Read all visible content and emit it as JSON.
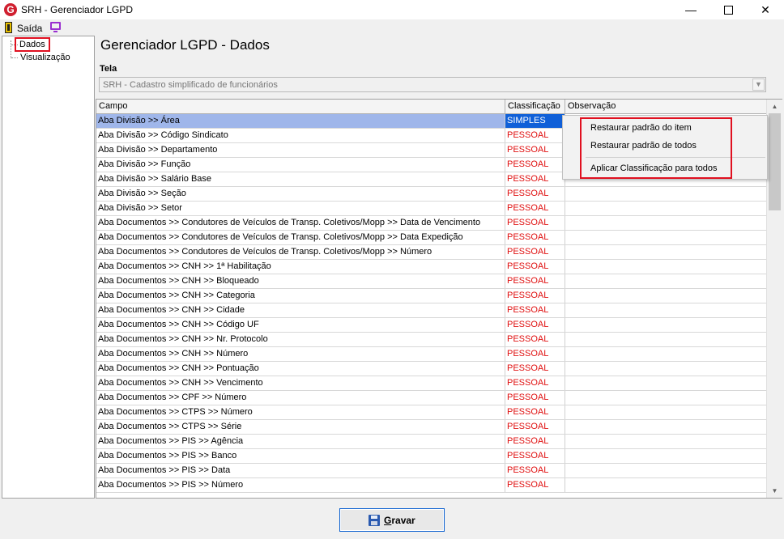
{
  "window": {
    "title": "SRH - Gerenciador LGPD",
    "logo_letter": "G",
    "minimize": "—",
    "close": "✕"
  },
  "toolbar": {
    "exit_label": "Saída"
  },
  "tree": {
    "items": [
      "Dados",
      "Visualização"
    ]
  },
  "main": {
    "title": "Gerenciador LGPD - Dados",
    "tela_label": "Tela",
    "tela_value": "SRH - Cadastro simplificado de funcionários"
  },
  "grid": {
    "columns": [
      "Campo",
      "Classificação",
      "Observação"
    ],
    "rows": [
      {
        "campo": "Aba Divisão >> Área",
        "classificacao": "SIMPLES",
        "observacao": ""
      },
      {
        "campo": "Aba Divisão >> Código Sindicato",
        "classificacao": "PESSOAL",
        "observacao": ""
      },
      {
        "campo": "Aba Divisão >> Departamento",
        "classificacao": "PESSOAL",
        "observacao": ""
      },
      {
        "campo": "Aba Divisão >> Função",
        "classificacao": "PESSOAL",
        "observacao": ""
      },
      {
        "campo": "Aba Divisão >> Salário Base",
        "classificacao": "PESSOAL",
        "observacao": ""
      },
      {
        "campo": "Aba Divisão >> Seção",
        "classificacao": "PESSOAL",
        "observacao": ""
      },
      {
        "campo": "Aba Divisão >> Setor",
        "classificacao": "PESSOAL",
        "observacao": ""
      },
      {
        "campo": "Aba Documentos >>  Condutores de Veículos de Transp. Coletivos/Mopp >> Data de Vencimento",
        "classificacao": "PESSOAL",
        "observacao": ""
      },
      {
        "campo": "Aba Documentos >>  Condutores de Veículos de Transp. Coletivos/Mopp >> Data Expedição",
        "classificacao": "PESSOAL",
        "observacao": ""
      },
      {
        "campo": "Aba Documentos >>  Condutores de Veículos de Transp. Coletivos/Mopp >> Número",
        "classificacao": "PESSOAL",
        "observacao": ""
      },
      {
        "campo": "Aba Documentos >> CNH >> 1ª Habilitação",
        "classificacao": "PESSOAL",
        "observacao": ""
      },
      {
        "campo": "Aba Documentos >> CNH >> Bloqueado",
        "classificacao": "PESSOAL",
        "observacao": ""
      },
      {
        "campo": "Aba Documentos >> CNH >> Categoria",
        "classificacao": "PESSOAL",
        "observacao": ""
      },
      {
        "campo": "Aba Documentos >> CNH >> Cidade",
        "classificacao": "PESSOAL",
        "observacao": ""
      },
      {
        "campo": "Aba Documentos >> CNH >> Código UF",
        "classificacao": "PESSOAL",
        "observacao": ""
      },
      {
        "campo": "Aba Documentos >> CNH >> Nr. Protocolo",
        "classificacao": "PESSOAL",
        "observacao": ""
      },
      {
        "campo": "Aba Documentos >> CNH >> Número",
        "classificacao": "PESSOAL",
        "observacao": ""
      },
      {
        "campo": "Aba Documentos >> CNH >> Pontuação",
        "classificacao": "PESSOAL",
        "observacao": ""
      },
      {
        "campo": "Aba Documentos >> CNH >> Vencimento",
        "classificacao": "PESSOAL",
        "observacao": ""
      },
      {
        "campo": "Aba Documentos >> CPF >> Número",
        "classificacao": "PESSOAL",
        "observacao": ""
      },
      {
        "campo": "Aba Documentos >> CTPS >> Número",
        "classificacao": "PESSOAL",
        "observacao": ""
      },
      {
        "campo": "Aba Documentos >> CTPS >> Série",
        "classificacao": "PESSOAL",
        "observacao": ""
      },
      {
        "campo": "Aba Documentos >> PIS >> Agência",
        "classificacao": "PESSOAL",
        "observacao": ""
      },
      {
        "campo": "Aba Documentos >> PIS >> Banco",
        "classificacao": "PESSOAL",
        "observacao": ""
      },
      {
        "campo": "Aba Documentos >> PIS >> Data",
        "classificacao": "PESSOAL",
        "observacao": ""
      },
      {
        "campo": "Aba Documentos >> PIS >> Número",
        "classificacao": "PESSOAL",
        "observacao": ""
      }
    ]
  },
  "context_menu": {
    "items": [
      "Restaurar padrão do item",
      "Restaurar padrão de todos",
      "Aplicar Classificação para todos"
    ]
  },
  "button": {
    "gravar_first": "G",
    "gravar_rest": "ravar"
  },
  "colors": {
    "accent_red": "#e01020",
    "selection_blue": "#1060d8",
    "row_selection": "#9fb6ea",
    "pessoal_text": "#e01010",
    "exit_icon": "#e8c000",
    "monitor_icon": "#9a2fd0"
  },
  "icons": {
    "app": "srh-logo-icon",
    "exit": "exit-door-icon",
    "monitor": "monitor-icon",
    "save": "floppy-disk-icon",
    "combo": "chevron-down-icon"
  }
}
